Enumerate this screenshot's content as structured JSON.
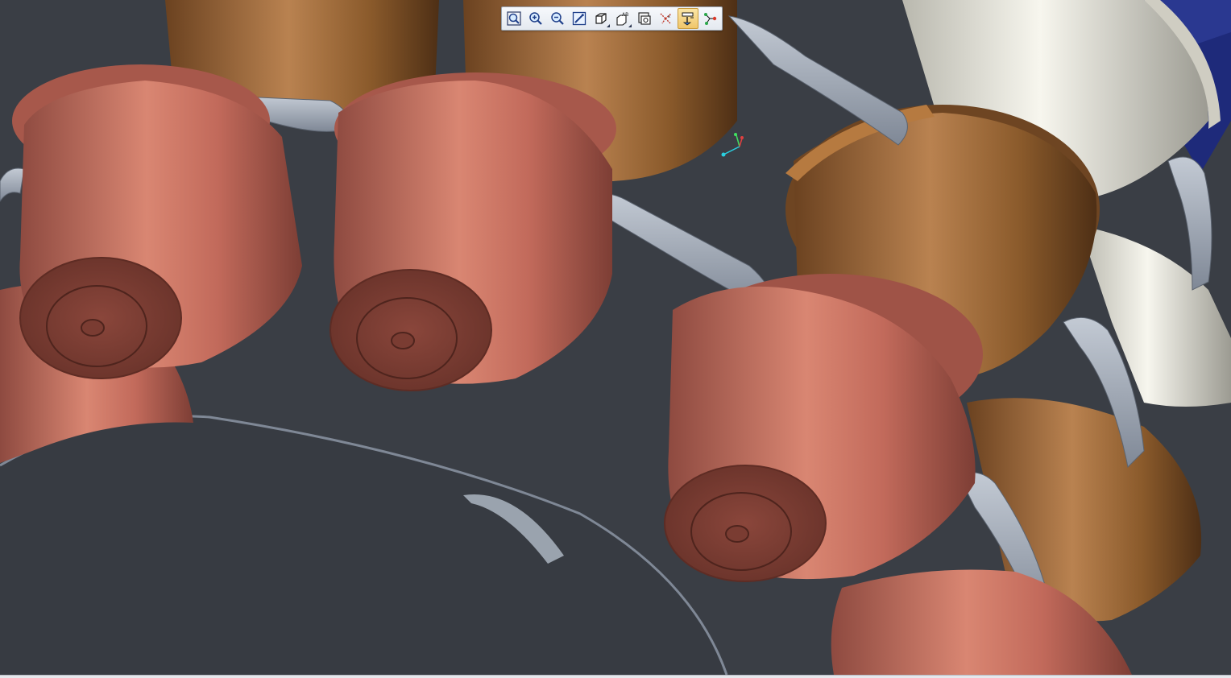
{
  "app": {
    "kind": "cad-3d-viewer"
  },
  "toolbar": {
    "buttons": [
      {
        "name": "refit-button",
        "icon": "refit-icon",
        "active": false,
        "flyout": false
      },
      {
        "name": "zoom-in-button",
        "icon": "zoom-in-icon",
        "active": false,
        "flyout": false
      },
      {
        "name": "zoom-out-button",
        "icon": "zoom-out-icon",
        "active": false,
        "flyout": false
      },
      {
        "name": "repaint-button",
        "icon": "repaint-icon",
        "active": false,
        "flyout": false
      },
      {
        "name": "display-style-button",
        "icon": "shaded-cube-icon",
        "active": false,
        "flyout": true
      },
      {
        "name": "saved-views-button",
        "icon": "saved-views-icon",
        "active": false,
        "flyout": true
      },
      {
        "name": "view-manager-button",
        "icon": "view-manager-icon",
        "active": false,
        "flyout": false
      },
      {
        "name": "datum-planes-button",
        "icon": "datum-planes-icon",
        "active": false,
        "flyout": false
      },
      {
        "name": "spin-center-button",
        "icon": "spin-center-icon",
        "active": true,
        "flyout": false
      },
      {
        "name": "annotations-button",
        "icon": "datum-points-icon",
        "active": false,
        "flyout": false
      }
    ],
    "saved_views_glyph": "AB"
  },
  "colors": {
    "background": "#3a3e45",
    "copper_capsule": "#c46a5c",
    "brown_capsule": "#8a5a2b",
    "white_capsule": "#e8e6da",
    "fin_edge": "#9fa8b5",
    "blue_part": "#1e2a7a"
  }
}
